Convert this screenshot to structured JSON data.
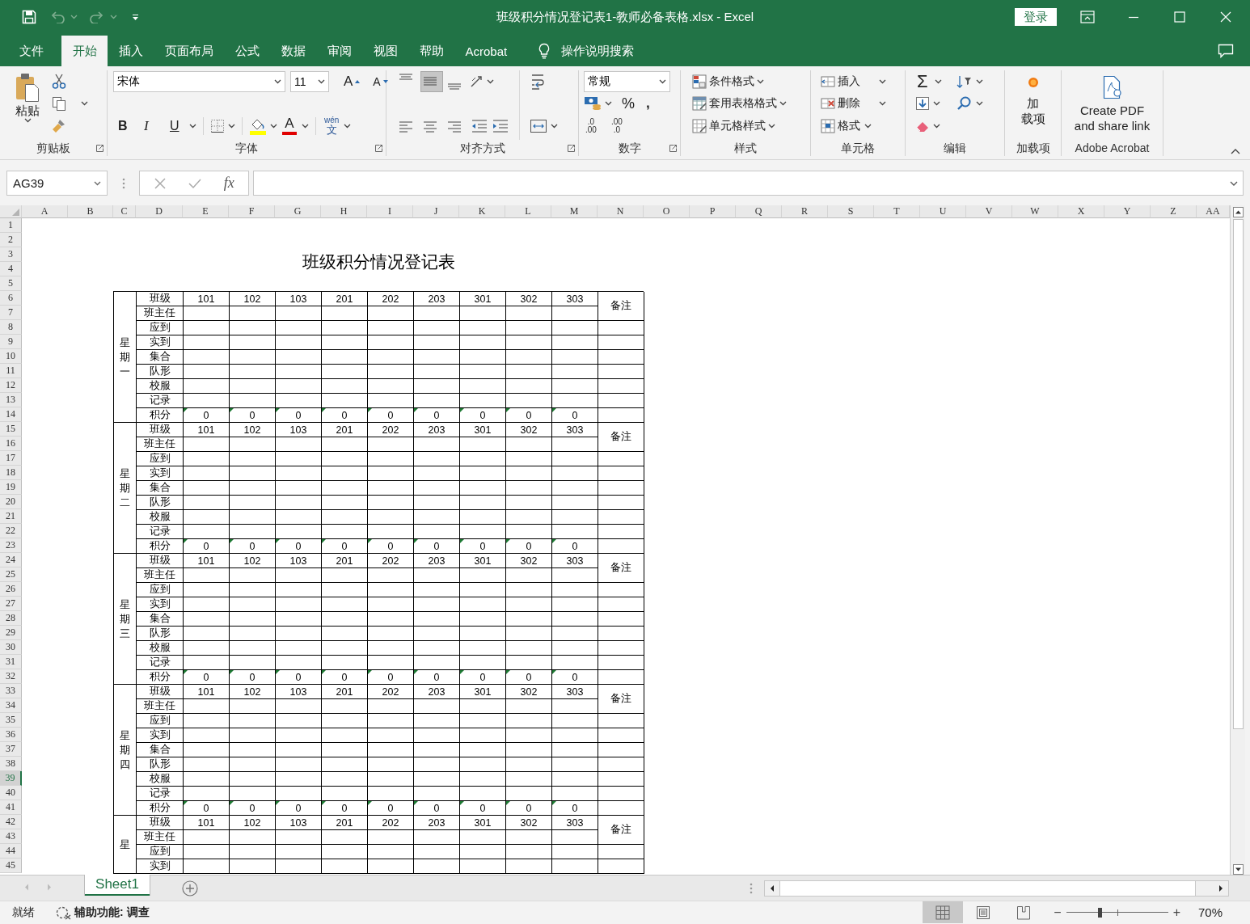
{
  "window": {
    "title": "班级积分情况登记表1-教师必备表格.xlsx - Excel",
    "login": "登录",
    "undo": {
      "disabled": true
    },
    "redo": {
      "disabled": true
    }
  },
  "tabs": [
    {
      "label": "文件",
      "selected": false
    },
    {
      "label": "开始",
      "selected": true
    },
    {
      "label": "插入",
      "selected": false
    },
    {
      "label": "页面布局",
      "selected": false
    },
    {
      "label": "公式",
      "selected": false
    },
    {
      "label": "数据",
      "selected": false
    },
    {
      "label": "审阅",
      "selected": false
    },
    {
      "label": "视图",
      "selected": false
    },
    {
      "label": "帮助",
      "selected": false
    },
    {
      "label": "Acrobat",
      "selected": false
    }
  ],
  "search": {
    "placeholder": "操作说明搜索"
  },
  "ribbon": {
    "clipboard": {
      "label": "剪贴板",
      "paste": "粘贴"
    },
    "font": {
      "label": "字体",
      "font_name": "宋体",
      "font_size": "11",
      "grow": "A",
      "shrink": "A",
      "bold": "B",
      "italic": "I",
      "underline": "U",
      "font_color": "A",
      "phonetic": [
        "wén",
        "文"
      ]
    },
    "alignment": {
      "label": "对齐方式",
      "vertical": [
        {
          "selected": false
        },
        {
          "selected": true
        },
        {
          "selected": false
        }
      ]
    },
    "number": {
      "label": "数字",
      "format": "常规",
      "percent": "%",
      "comma": ",",
      "increase_decimal": [
        ".0",
        ".00"
      ],
      "decrease_decimal": [
        ".00",
        ".0"
      ]
    },
    "styles": {
      "label": "样式",
      "items": [
        "条件格式",
        "套用表格格式",
        "单元格样式"
      ]
    },
    "cells": {
      "label": "单元格",
      "items": [
        "插入",
        "删除",
        "格式"
      ]
    },
    "editing": {
      "label": "编辑",
      "sum": "Σ"
    },
    "addins": {
      "label": "加载项",
      "button": [
        "加",
        "载项"
      ]
    },
    "acrobat": {
      "label": "Adobe Acrobat",
      "button": [
        "Create PDF",
        "and share link"
      ]
    }
  },
  "formula_bar": {
    "name_box": "AG39",
    "fx": "fx"
  },
  "sheet": {
    "columns": [
      "A",
      "B",
      "C",
      "D",
      "E",
      "F",
      "G",
      "H",
      "I",
      "J",
      "K",
      "L",
      "M",
      "N",
      "O",
      "P",
      "Q",
      "R",
      "S",
      "T",
      "U",
      "V",
      "W",
      "X",
      "Y",
      "Z",
      "AA"
    ],
    "rows": [
      {
        "label": "1",
        "selected": false
      },
      {
        "label": "2",
        "selected": false
      },
      {
        "label": "3",
        "selected": false
      },
      {
        "label": "4",
        "selected": false
      },
      {
        "label": "5",
        "selected": false
      },
      {
        "label": "6",
        "selected": false
      },
      {
        "label": "7",
        "selected": false
      },
      {
        "label": "8",
        "selected": false
      },
      {
        "label": "9",
        "selected": false
      },
      {
        "label": "10",
        "selected": false
      },
      {
        "label": "11",
        "selected": false
      },
      {
        "label": "12",
        "selected": false
      },
      {
        "label": "13",
        "selected": false
      },
      {
        "label": "14",
        "selected": false
      },
      {
        "label": "15",
        "selected": false
      },
      {
        "label": "16",
        "selected": false
      },
      {
        "label": "17",
        "selected": false
      },
      {
        "label": "18",
        "selected": false
      },
      {
        "label": "19",
        "selected": false
      },
      {
        "label": "20",
        "selected": false
      },
      {
        "label": "21",
        "selected": false
      },
      {
        "label": "22",
        "selected": false
      },
      {
        "label": "23",
        "selected": false
      },
      {
        "label": "24",
        "selected": false
      },
      {
        "label": "25",
        "selected": false
      },
      {
        "label": "26",
        "selected": false
      },
      {
        "label": "27",
        "selected": false
      },
      {
        "label": "28",
        "selected": false
      },
      {
        "label": "29",
        "selected": false
      },
      {
        "label": "30",
        "selected": false
      },
      {
        "label": "31",
        "selected": false
      },
      {
        "label": "32",
        "selected": false
      },
      {
        "label": "33",
        "selected": false
      },
      {
        "label": "34",
        "selected": false
      },
      {
        "label": "35",
        "selected": false
      },
      {
        "label": "36",
        "selected": false
      },
      {
        "label": "37",
        "selected": false
      },
      {
        "label": "38",
        "selected": false
      },
      {
        "label": "39",
        "selected": true
      },
      {
        "label": "40",
        "selected": false
      },
      {
        "label": "41",
        "selected": false
      },
      {
        "label": "42",
        "selected": false
      },
      {
        "label": "43",
        "selected": false
      },
      {
        "label": "44",
        "selected": false
      },
      {
        "label": "45",
        "selected": false
      }
    ],
    "title": "班级积分情况登记表",
    "blocks": [
      {
        "day": "星期一",
        "note": "备注",
        "rows": [
          {
            "kind": "header",
            "label": "班级",
            "cells": [
              "101",
              "102",
              "103",
              "201",
              "202",
              "203",
              "301",
              "302",
              "303"
            ]
          },
          {
            "kind": "blank",
            "label": "班主任"
          },
          {
            "kind": "blank",
            "label": "应到"
          },
          {
            "kind": "blank",
            "label": "实到"
          },
          {
            "kind": "blank",
            "label": "集合"
          },
          {
            "kind": "blank",
            "label": "队形"
          },
          {
            "kind": "blank",
            "label": "校服"
          },
          {
            "kind": "blank",
            "label": "记录"
          },
          {
            "kind": "score",
            "label": "积分",
            "cells": [
              "0",
              "0",
              "0",
              "0",
              "0",
              "0",
              "0",
              "0",
              "0"
            ]
          }
        ]
      },
      {
        "day": "星期二",
        "note": "备注",
        "rows": [
          {
            "kind": "header",
            "label": "班级",
            "cells": [
              "101",
              "102",
              "103",
              "201",
              "202",
              "203",
              "301",
              "302",
              "303"
            ]
          },
          {
            "kind": "blank",
            "label": "班主任"
          },
          {
            "kind": "blank",
            "label": "应到"
          },
          {
            "kind": "blank",
            "label": "实到"
          },
          {
            "kind": "blank",
            "label": "集合"
          },
          {
            "kind": "blank",
            "label": "队形"
          },
          {
            "kind": "blank",
            "label": "校服"
          },
          {
            "kind": "blank",
            "label": "记录"
          },
          {
            "kind": "score",
            "label": "积分",
            "cells": [
              "0",
              "0",
              "0",
              "0",
              "0",
              "0",
              "0",
              "0",
              "0"
            ]
          }
        ]
      },
      {
        "day": "星期三",
        "note": "备注",
        "rows": [
          {
            "kind": "header",
            "label": "班级",
            "cells": [
              "101",
              "102",
              "103",
              "201",
              "202",
              "203",
              "301",
              "302",
              "303"
            ]
          },
          {
            "kind": "blank",
            "label": "班主任"
          },
          {
            "kind": "blank",
            "label": "应到"
          },
          {
            "kind": "blank",
            "label": "实到"
          },
          {
            "kind": "blank",
            "label": "集合"
          },
          {
            "kind": "blank",
            "label": "队形"
          },
          {
            "kind": "blank",
            "label": "校服"
          },
          {
            "kind": "blank",
            "label": "记录"
          },
          {
            "kind": "score",
            "label": "积分",
            "cells": [
              "0",
              "0",
              "0",
              "0",
              "0",
              "0",
              "0",
              "0",
              "0"
            ]
          }
        ]
      },
      {
        "day": "星期四",
        "note": "备注",
        "rows": [
          {
            "kind": "header",
            "label": "班级",
            "cells": [
              "101",
              "102",
              "103",
              "201",
              "202",
              "203",
              "301",
              "302",
              "303"
            ]
          },
          {
            "kind": "blank",
            "label": "班主任"
          },
          {
            "kind": "blank",
            "label": "应到"
          },
          {
            "kind": "blank",
            "label": "实到"
          },
          {
            "kind": "blank",
            "label": "集合"
          },
          {
            "kind": "blank",
            "label": "队形"
          },
          {
            "kind": "blank",
            "label": "校服"
          },
          {
            "kind": "blank",
            "label": "记录"
          },
          {
            "kind": "score",
            "label": "积分",
            "cells": [
              "0",
              "0",
              "0",
              "0",
              "0",
              "0",
              "0",
              "0",
              "0"
            ]
          }
        ]
      },
      {
        "day": "星",
        "note": "备注",
        "rows": [
          {
            "kind": "header",
            "label": "班级",
            "cells": [
              "101",
              "102",
              "103",
              "201",
              "202",
              "203",
              "301",
              "302",
              "303"
            ]
          },
          {
            "kind": "blank",
            "label": "班主任"
          },
          {
            "kind": "blank",
            "label": "应到"
          },
          {
            "kind": "blank",
            "label": "实到"
          }
        ]
      }
    ]
  },
  "sheet_tabs": [
    {
      "label": "Sheet1",
      "selected": true
    }
  ],
  "status_bar": {
    "ready": "就绪",
    "accessibility": "辅助功能: 调查",
    "views": [
      {
        "selected": true
      },
      {
        "selected": false
      },
      {
        "selected": false
      }
    ],
    "zoom_out": "−",
    "zoom_in": "+",
    "zoom": {
      "level": 0.33,
      "reading": "70%"
    }
  }
}
